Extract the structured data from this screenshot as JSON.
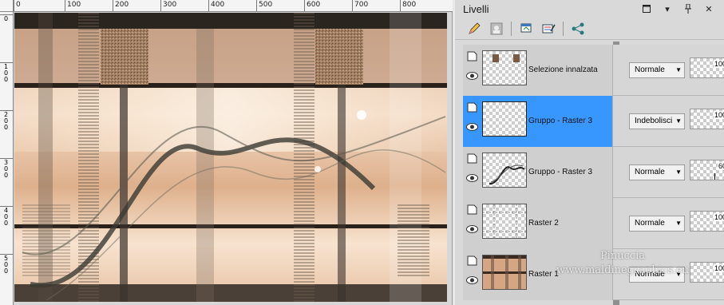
{
  "rulers": {
    "top_labels": [
      "0",
      "100",
      "200",
      "300",
      "400",
      "500",
      "600",
      "700",
      "800"
    ],
    "left_labels": [
      "0",
      "100",
      "200",
      "300",
      "400",
      "500"
    ]
  },
  "layers_panel": {
    "title": "Livelli",
    "layers": [
      {
        "name": "Selezione innalzata",
        "blend": "Normale",
        "opacity": "100",
        "selected": false
      },
      {
        "name": "Gruppo - Raster 3",
        "blend": "Indebolisci",
        "opacity": "100",
        "selected": true
      },
      {
        "name": "Gruppo - Raster 3",
        "blend": "Normale",
        "opacity": "60",
        "selected": false
      },
      {
        "name": "Raster 2",
        "blend": "Normale",
        "opacity": "100",
        "selected": false
      },
      {
        "name": "Raster 1",
        "blend": "Normale",
        "opacity": "100",
        "selected": false
      }
    ],
    "opacity_levels": [
      1.0,
      1.0,
      0.6,
      1.0,
      1.0
    ]
  },
  "watermark": {
    "line1": "Pinuccia",
    "line2": "www.maldinegraphics.eu"
  },
  "colors": {
    "selection": "#3797ff",
    "panel_bg": "#d9d9d9",
    "artwork_peach": "#e8c2a4",
    "artwork_dark": "#3a2a20"
  }
}
